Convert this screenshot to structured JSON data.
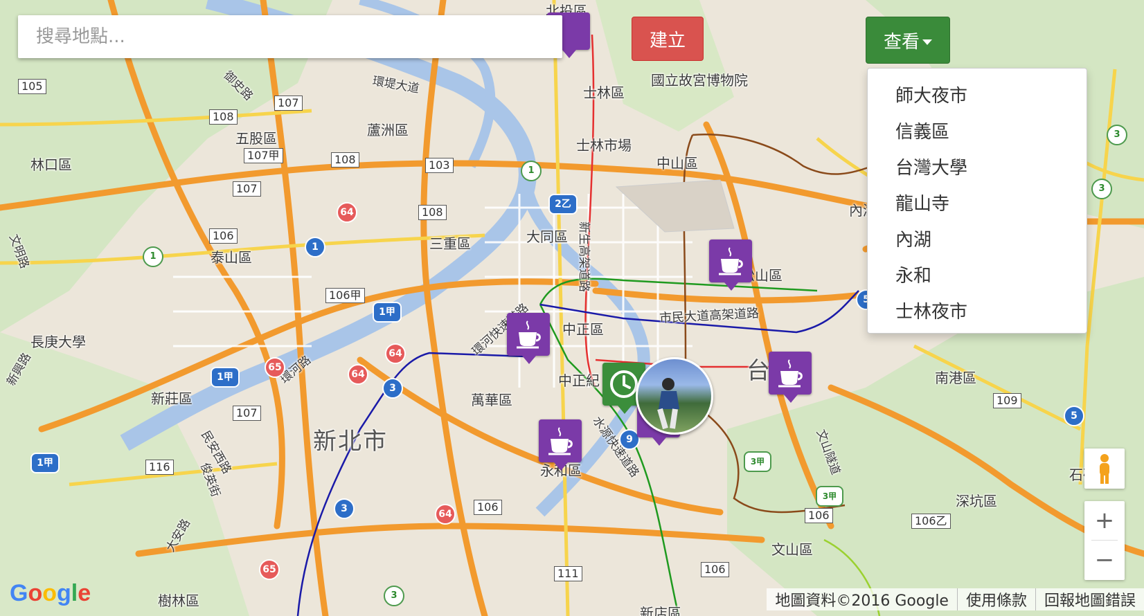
{
  "search": {
    "placeholder": "搜尋地點..."
  },
  "toolbar": {
    "create_label": "建立",
    "view_label": "查看"
  },
  "view_menu": {
    "items": [
      "師大夜市",
      "信義區",
      "台灣大學",
      "龍山寺",
      "內湖",
      "永和",
      "士林夜市"
    ]
  },
  "zoom": {
    "in_label": "+",
    "out_label": "−"
  },
  "footer": {
    "map_data": "地圖資料©2016 Google",
    "terms": "使用條款",
    "report": "回報地圖錯誤"
  },
  "logo": {
    "text": "Google"
  },
  "map_labels": {
    "city": "新北市",
    "districts": [
      "北投區",
      "士林區",
      "國立故宮博物院",
      "士林市場",
      "中山區",
      "蘆洲區",
      "五股區",
      "林口區",
      "三重區",
      "大同區",
      "泰山區",
      "松山區",
      "中正區",
      "萬華區",
      "新莊區",
      "永和區",
      "長庚大學",
      "南港區",
      "深坑區",
      "文山區",
      "樹林區",
      "新店區",
      "台",
      "內湖",
      "石碇"
    ],
    "roads": [
      "市民大道高架道路",
      "環河快速道路",
      "水源快速道路",
      "環堤大道",
      "新生高架道路",
      "文山隧道",
      "環河路",
      "民安西路",
      "大安路",
      "俊英街",
      "御史路",
      "新興路",
      "文明路",
      "中正紀"
    ],
    "shields": [
      "105",
      "107",
      "108",
      "107甲",
      "108",
      "103",
      "107",
      "106",
      "106甲",
      "107",
      "116",
      "106",
      "111",
      "106",
      "109",
      "106",
      "106乙",
      "108"
    ],
    "expressways": [
      "64",
      "64",
      "64",
      "64",
      "65",
      "65"
    ],
    "provincial": [
      "1",
      "1甲",
      "1甲",
      "1甲",
      "3",
      "3",
      "5",
      "5",
      "2乙",
      "9"
    ],
    "county": [
      "1",
      "1",
      "3",
      "3",
      "3",
      "3甲",
      "3甲"
    ]
  },
  "markers": {
    "cafe": [
      "cafe-xinyi",
      "cafe-songshan",
      "cafe-wanhua",
      "cafe-yonghe",
      "cafe-daan"
    ],
    "clock": "clock-marker",
    "avatar": "user-avatar"
  },
  "colors": {
    "create": "#d9534f",
    "view": "#3a8b3a",
    "poi": "#7b3aa8",
    "poi_green": "#3b8e3b"
  }
}
